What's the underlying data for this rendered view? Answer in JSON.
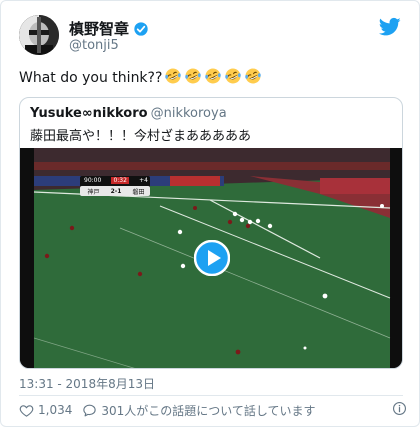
{
  "colors": {
    "text": "#14171a",
    "muted": "#657786",
    "border": "#ccd6dd",
    "brand": "#1da1f2",
    "pitch": "#2f6b3a",
    "play": "#1da1f2"
  },
  "author": {
    "name": "槙野智章",
    "handle": "@tonji5",
    "verified": true,
    "avatar_icon": "avatar-photo",
    "logo_icon": "twitter-bird-icon"
  },
  "tweet": {
    "text": "What do you think??",
    "emoji_icon": "rolling-on-floor-laughing-emoji",
    "emoji_count": 5
  },
  "quoted": {
    "name": "Yusuke∞nikkoro",
    "handle": "@nikkoroya",
    "text": "藤田最高や！！！今村ざまあああああ",
    "video": {
      "scoreboard_clock": "90:00",
      "scoreboard_added": "0:32",
      "scoreboard_plus": "+4",
      "home_team": "神戸",
      "score": "2-1",
      "away_team": "磐田",
      "play_icon": "play-icon"
    }
  },
  "timestamp": "13:31 - 2018年8月13日",
  "actions": {
    "like_icon": "heart-icon",
    "likes": "1,034",
    "reply_icon": "reply-bubble-icon",
    "talking": "301人がこの話題について話しています",
    "info_icon": "info-icon"
  }
}
